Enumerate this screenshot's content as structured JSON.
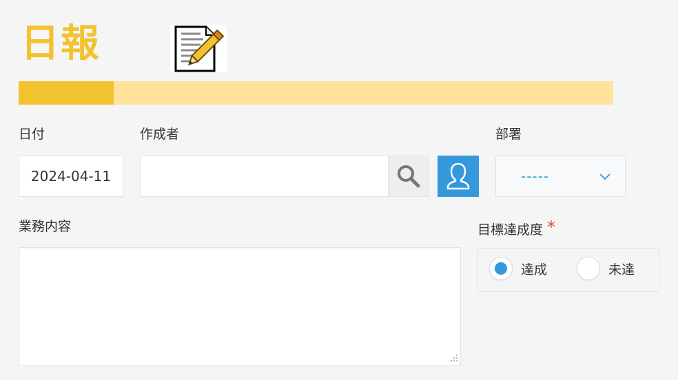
{
  "header": {
    "title": "日報",
    "progress": 0.16,
    "colors": {
      "accent": "#f3c230",
      "track": "#ffe39a"
    }
  },
  "fields": {
    "date": {
      "label": "日付",
      "value": "2024-04-11"
    },
    "author": {
      "label": "作成者",
      "value": "",
      "search_icon": "search-icon",
      "user_icon": "user-icon"
    },
    "department": {
      "label": "部署",
      "selected": "-----"
    },
    "work": {
      "label": "業務内容",
      "value": ""
    },
    "achievement": {
      "label": "目標達成度",
      "required_mark": "*",
      "options": [
        {
          "label": "達成",
          "checked": true
        },
        {
          "label": "未達",
          "checked": false
        }
      ]
    }
  },
  "colors": {
    "primary": "#3498db",
    "required": "#e74c3c"
  }
}
